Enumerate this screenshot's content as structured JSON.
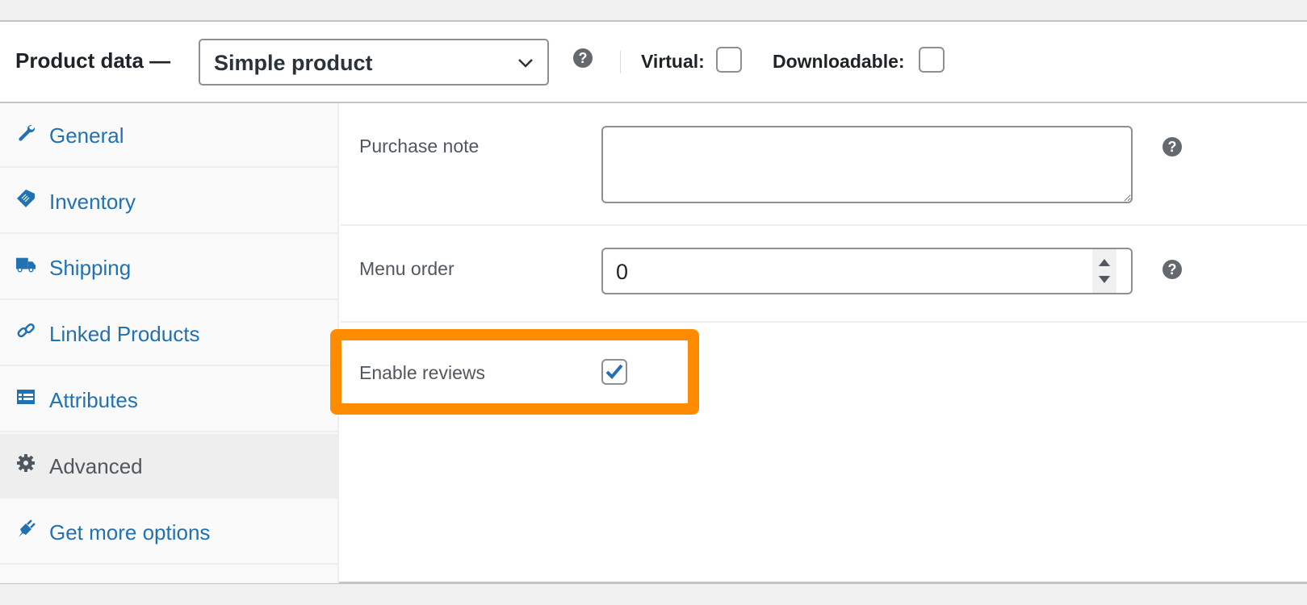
{
  "header": {
    "title": "Product data —",
    "product_type": "Simple product",
    "help_icon": "help-icon",
    "virtual_label": "Virtual:",
    "virtual_checked": false,
    "downloadable_label": "Downloadable:",
    "downloadable_checked": false
  },
  "tabs": [
    {
      "label": "General",
      "icon": "wrench-icon",
      "active": false
    },
    {
      "label": "Inventory",
      "icon": "tag-icon",
      "active": false
    },
    {
      "label": "Shipping",
      "icon": "truck-icon",
      "active": false
    },
    {
      "label": "Linked Products",
      "icon": "link-icon",
      "active": false
    },
    {
      "label": "Attributes",
      "icon": "list-icon",
      "active": false
    },
    {
      "label": "Advanced",
      "icon": "gear-icon",
      "active": true
    },
    {
      "label": "Get more options",
      "icon": "plug-icon",
      "active": false
    }
  ],
  "advanced": {
    "purchase_note_label": "Purchase note",
    "purchase_note_value": "",
    "menu_order_label": "Menu order",
    "menu_order_value": "0",
    "enable_reviews_label": "Enable reviews",
    "enable_reviews_checked": true
  },
  "colors": {
    "link": "#2271b1",
    "highlight": "#ff8c00",
    "help": "#646970"
  }
}
